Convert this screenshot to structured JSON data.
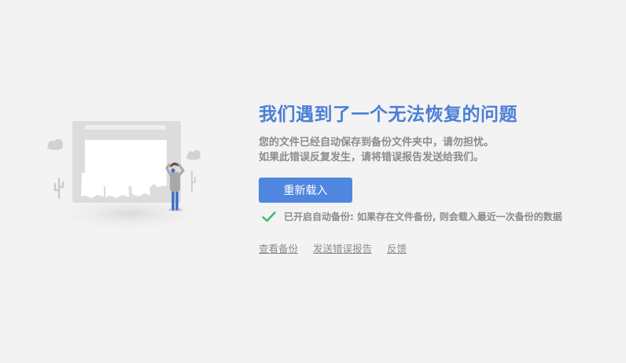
{
  "error": {
    "title": "我们遇到了一个无法恢复的问题",
    "description": [
      "您的文件已经自动保存到备份文件夹中，请勿担忧。",
      "如果此错误反复发生，请将错误报告发送给我们。"
    ]
  },
  "actions": {
    "reload_label": "重新载入"
  },
  "backup_status": {
    "icon": "check-icon",
    "text": "已开启自动备份: 如果存在文件备份, 则会载入最近一次备份的数据"
  },
  "links": {
    "view_backup": "查看备份",
    "send_report": "发送错误报告",
    "feedback": "反馈"
  },
  "colors": {
    "background": "#f3f3f3",
    "accent": "#4a7fd6",
    "button": "#4f86e0",
    "check": "#39b86a",
    "text_muted": "#8c8c8c"
  }
}
